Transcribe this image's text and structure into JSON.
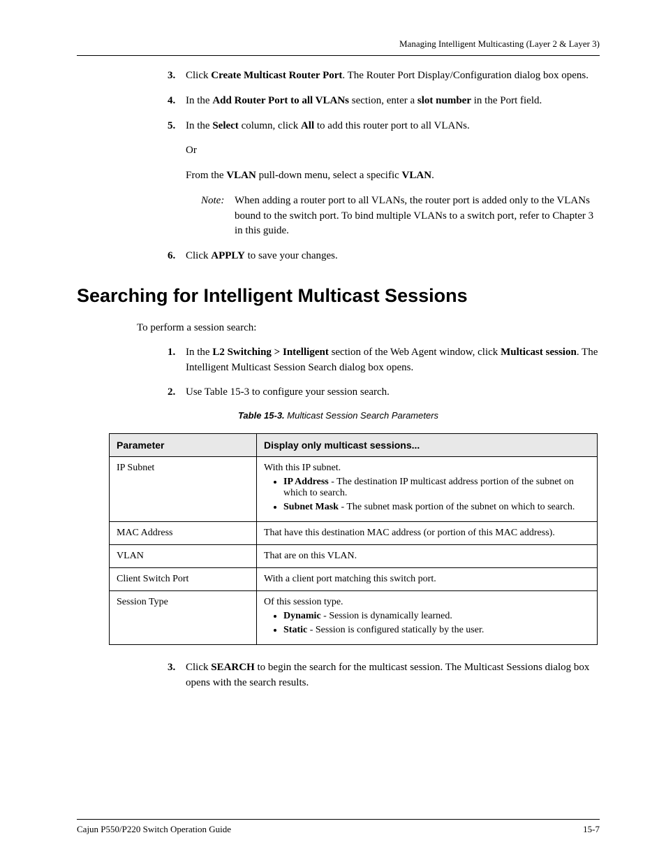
{
  "header": {
    "title": "Managing Intelligent Multicasting (Layer 2 & Layer 3)"
  },
  "steps_a": {
    "n3": "3.",
    "s3_a": "Click ",
    "s3_b": "Create Multicast Router Port",
    "s3_c": ". The Router Port Display/Configuration dialog box opens.",
    "n4": "4.",
    "s4_a": "In the ",
    "s4_b": "Add Router Port to all VLANs",
    "s4_c": " section, enter a ",
    "s4_d": "slot number",
    "s4_e": " in the Port field.",
    "n5": "5.",
    "s5_a": "In the ",
    "s5_b": "Select",
    "s5_c": " column, click ",
    "s5_d": "All",
    "s5_e": " to add this router port to all VLANs.",
    "or": "Or",
    "s5b_a": "From the ",
    "s5b_b": "VLAN",
    "s5b_c": " pull-down menu, select a specific ",
    "s5b_d": "VLAN",
    "s5b_e": ".",
    "note_label": "Note:",
    "note_text": "When adding a router port to all VLANs, the router port is added only to the VLANs bound to the switch port. To bind multiple VLANs to a switch port, refer to Chapter 3 in this guide.",
    "n6": "6.",
    "s6_a": "Click ",
    "s6_b": "APPLY",
    "s6_c": " to save your changes."
  },
  "h1": "Searching for Intelligent Multicast Sessions",
  "intro": "To perform a session search:",
  "steps_b": {
    "n1": "1.",
    "s1_a": "In the ",
    "s1_b": "L2 Switching > Intelligent",
    "s1_c": " section of the Web Agent window, click ",
    "s1_d": "Multicast session",
    "s1_e": ". The Intelligent Multicast Session Search dialog box opens.",
    "n2": "2.",
    "s2": "Use Table 15-3 to configure your session search.",
    "n3": "3.",
    "s3_a": "Click ",
    "s3_b": "SEARCH",
    "s3_c": " to begin the search for the multicast session. The Multicast Sessions dialog box opens with the search results."
  },
  "table": {
    "caption_a": "Table 15-3. ",
    "caption_b": "Multicast Session Search Parameters",
    "h1": "Parameter",
    "h2": "Display only multicast sessions...",
    "r1_p": "IP Subnet",
    "r1_a": "With this IP subnet.",
    "r1_b1_a": "IP Address",
    "r1_b1_b": " - The destination IP multicast address portion of the subnet on which to search.",
    "r1_b2_a": "Subnet Mask",
    "r1_b2_b": " - The subnet mask portion of the subnet on which to search.",
    "r2_p": "MAC Address",
    "r2_v": "That have this destination MAC address (or portion of this MAC address).",
    "r3_p": "VLAN",
    "r3_v": "That are on this VLAN.",
    "r4_p": "Client Switch Port",
    "r4_v": "With a client port matching this switch port.",
    "r5_p": "Session Type",
    "r5_a": "Of this session type.",
    "r5_b1_a": "Dynamic",
    "r5_b1_b": " - Session is dynamically learned.",
    "r5_b2_a": "Static",
    "r5_b2_b": " - Session is configured statically by the user."
  },
  "footer": {
    "left": "Cajun P550/P220 Switch Operation Guide",
    "right": "15-7"
  }
}
